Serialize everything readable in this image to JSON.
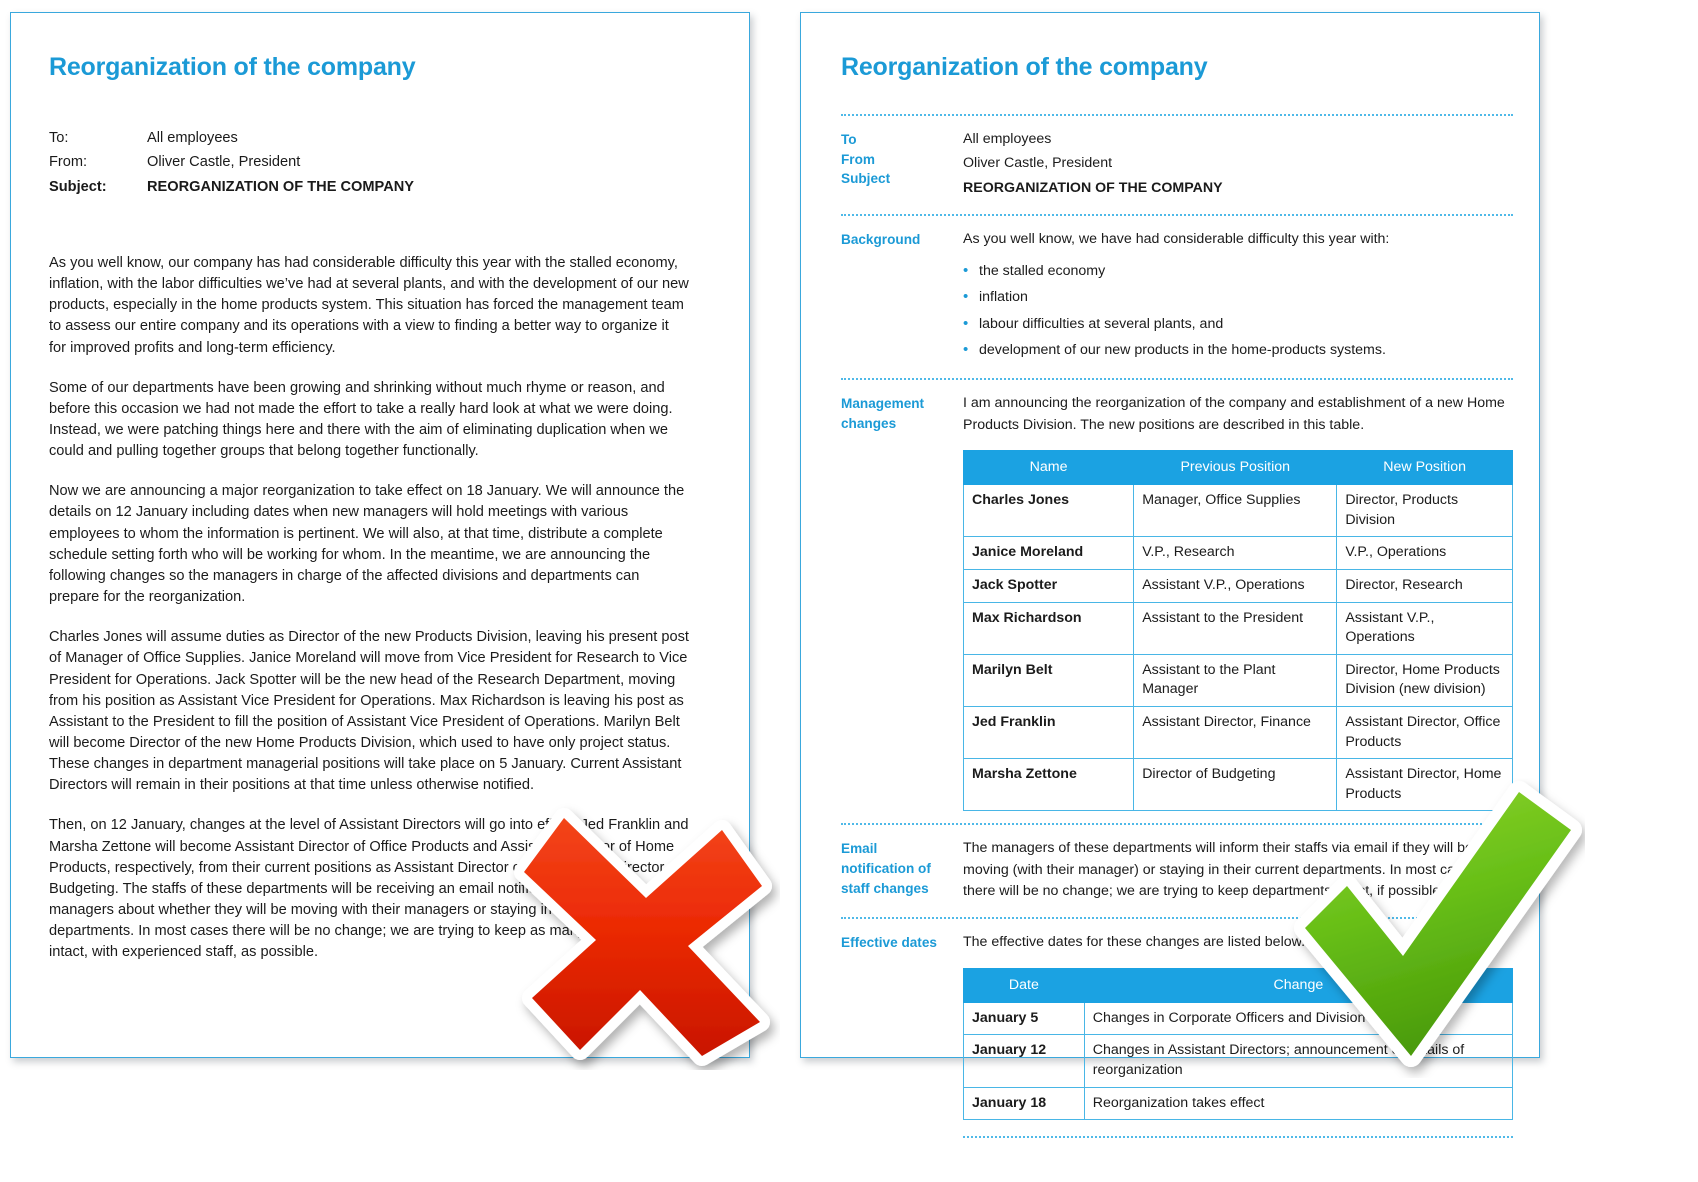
{
  "left_page": {
    "title": "Reorganization of the company",
    "meta": [
      {
        "label": "To:",
        "value": "All employees",
        "bold": false
      },
      {
        "label": "From:",
        "value": "Oliver Castle, President",
        "bold": false
      },
      {
        "label": "Subject:",
        "value": "REORGANIZATION OF THE COMPANY",
        "bold": true
      }
    ],
    "paragraphs": [
      "As you well know, our company has had considerable difficulty this year with the stalled economy, inflation, with the labor difficulties we’ve had at several plants, and with the development of our new products, especially in the home products system. This situation has forced the management team to assess our entire company and its operations with a view to finding a better way to organize it for improved profits and long-term efficiency.",
      "Some of our departments have been growing and shrinking without much rhyme or reason, and before this occasion we had not made the effort to take a really hard look at what we were doing. Instead, we were patching things here and there with the aim of eliminating duplication when we could and pulling together groups that belong together functionally.",
      "Now we are announcing a major reorganization to take effect on 18 January. We will announce the details on 12 January including dates when new managers will hold meetings with various employees to whom the information is pertinent. We will also, at that time, distribute a complete schedule setting forth who will be working for whom. In the meantime, we are announcing the following changes so the managers in charge of the affected divisions and departments can prepare for the reorganization.",
      "Charles Jones will assume duties as Director of the new Products Division, leaving his present post of Manager of Office Supplies. Janice Moreland will move from Vice President for Research to Vice President for Operations. Jack Spotter will be the new head of the Research Department, moving from his position as Assistant Vice President for Operations. Max Richardson is leaving his post as Assistant to the President to fill the position of Assistant Vice President of Operations. Marilyn Belt will become Director of the new Home Products Division, which used to have only project status. These changes in department managerial positions will take place on 5 January. Current Assistant Directors will remain in their positions at that time unless otherwise notified.",
      "Then, on 12 January, changes at the level of Assistant Directors will go into effect. Jed Franklin and Marsha Zettone will become Assistant Director of Office Products and Assistant Director of Home Products, respectively, from their current positions as Assistant Director of Finance and Director of Budgeting. The staffs of these departments will be receiving an email notification from their managers about whether they will be moving with their managers or staying in their current departments. In most cases there will be no change; we are trying to keep as many departments intact, with experienced staff, as possible."
    ]
  },
  "right_page": {
    "title": "Reorganization of the company",
    "meta_labels": [
      "To",
      "From",
      "Subject"
    ],
    "meta_values": [
      "All employees",
      "Oliver Castle, President",
      "REORGANIZATION OF THE COMPANY"
    ],
    "background": {
      "label": "Background",
      "intro": "As you well know, we have had considerable difficulty this year with:",
      "bullets": [
        "the stalled economy",
        "inflation",
        "labour difficulties at several plants, and",
        "development of our new products in the home-products systems."
      ]
    },
    "management": {
      "label_line1": "Management",
      "label_line2": "changes",
      "intro": "I am announcing the reorganization of the company and establishment of a new Home Products Division. The new positions are described in this table.",
      "table": {
        "headers": [
          "Name",
          "Previous Position",
          "New Position"
        ],
        "rows": [
          [
            "Charles Jones",
            "Manager, Office Supplies",
            "Director, Products Division"
          ],
          [
            "Janice Moreland",
            "V.P., Research",
            "V.P., Operations"
          ],
          [
            "Jack Spotter",
            "Assistant V.P., Operations",
            "Director, Research"
          ],
          [
            "Max Richardson",
            "Assistant to the President",
            "Assistant V.P., Operations"
          ],
          [
            "Marilyn Belt",
            "Assistant to the Plant Manager",
            "Director, Home Products Division (new division)"
          ],
          [
            "Jed Franklin",
            "Assistant Director, Finance",
            "Assistant Director, Office Products"
          ],
          [
            "Marsha Zettone",
            "Director of Budgeting",
            "Assistant Director, Home Products"
          ]
        ]
      }
    },
    "email_notification": {
      "label_line1": "Email",
      "label_line2": "notification of",
      "label_line3": "staff changes",
      "text": "The managers of these departments will inform their staffs via email if they will be moving (with their manager) or staying in their current departments. In most cases there will be no change; we are trying to keep departments intact, if possible."
    },
    "effective_dates": {
      "label": "Effective dates",
      "intro": "The effective dates for these changes are listed below.",
      "table": {
        "headers": [
          "Date",
          "Change"
        ],
        "rows": [
          [
            "January 5",
            "Changes in Corporate Officers and Division Chiefs"
          ],
          [
            "January 12",
            "Changes in Assistant Directors; announcement of details of reorganization"
          ],
          [
            "January 18",
            "Reorganization takes effect"
          ]
        ]
      }
    }
  },
  "marks": {
    "x_mark": "cross-mark-red",
    "check_mark": "check-mark-green"
  },
  "colors": {
    "accent": "#1b9ad6",
    "table_header": "#1ba2e2",
    "table_border": "#49b6e6",
    "x_red": "#e8340c",
    "check_green": "#66bb22"
  }
}
